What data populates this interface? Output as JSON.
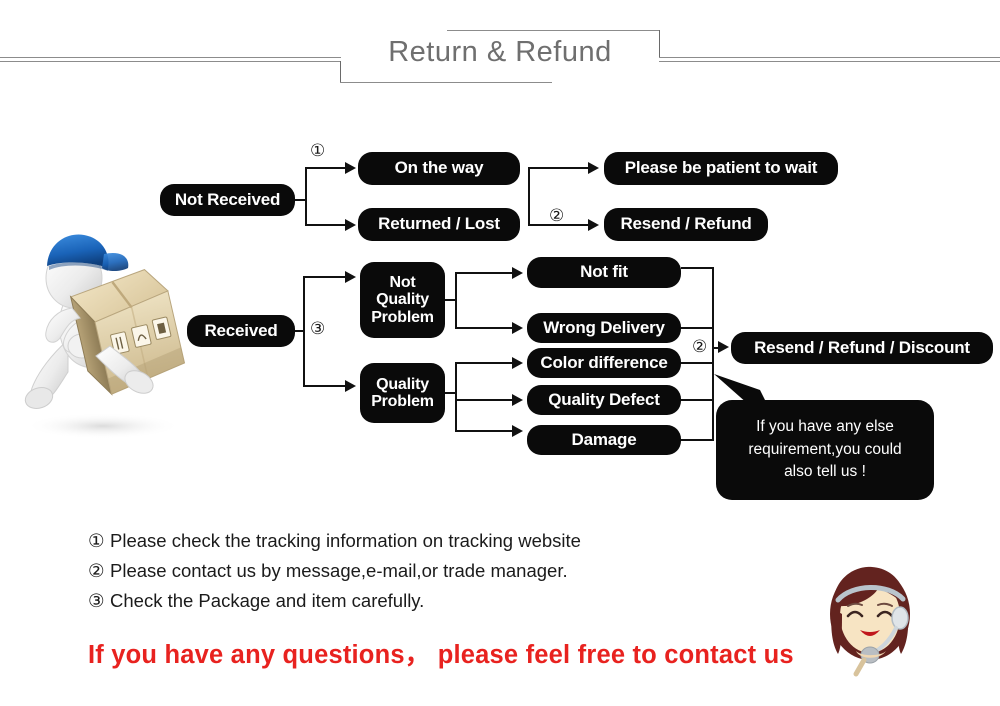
{
  "header": {
    "title": "Return & Refund"
  },
  "flow": {
    "not_received": "Not Received",
    "on_the_way": "On the way",
    "returned_lost": "Returned / Lost",
    "please_wait": "Please be patient to wait",
    "resend_refund": "Resend / Refund",
    "received": "Received",
    "not_quality_problem": "Not\nQuality\nProblem",
    "not_quality_problem_l1": "Not",
    "not_quality_problem_l2": "Quality",
    "not_quality_problem_l3": "Problem",
    "quality_problem_l1": "Quality",
    "quality_problem_l2": "Problem",
    "not_fit": "Not fit",
    "wrong_delivery": "Wrong Delivery",
    "color_difference": "Color difference",
    "quality_defect": "Quality Defect",
    "damage": "Damage",
    "resend_refund_discount": "Resend / Refund / Discount",
    "marker_1": "①",
    "marker_2": "②",
    "marker_2b": "②",
    "marker_3": "③"
  },
  "bubble": {
    "line1": "If you have any else",
    "line2": "requirement,you could",
    "line3": "also tell us !"
  },
  "notes": [
    {
      "num": "①",
      "text": "Please check the tracking information on tracking website"
    },
    {
      "num": "②",
      "text": "Please contact us by message,e-mail,or trade manager."
    },
    {
      "num": "③",
      "text": "Check the Package and item carefully."
    }
  ],
  "cta": "If you have any questions，  please feel free to contact us",
  "colors": {
    "box_fill": "#0a0a0a",
    "box_text": "#ffffff",
    "line": "#111111",
    "title_text": "#6f6f6f",
    "cta_text": "#e8221f",
    "cap_blue": "#1a63b8",
    "box_card": "#e6d7b0",
    "hair_brown": "#63231f"
  }
}
